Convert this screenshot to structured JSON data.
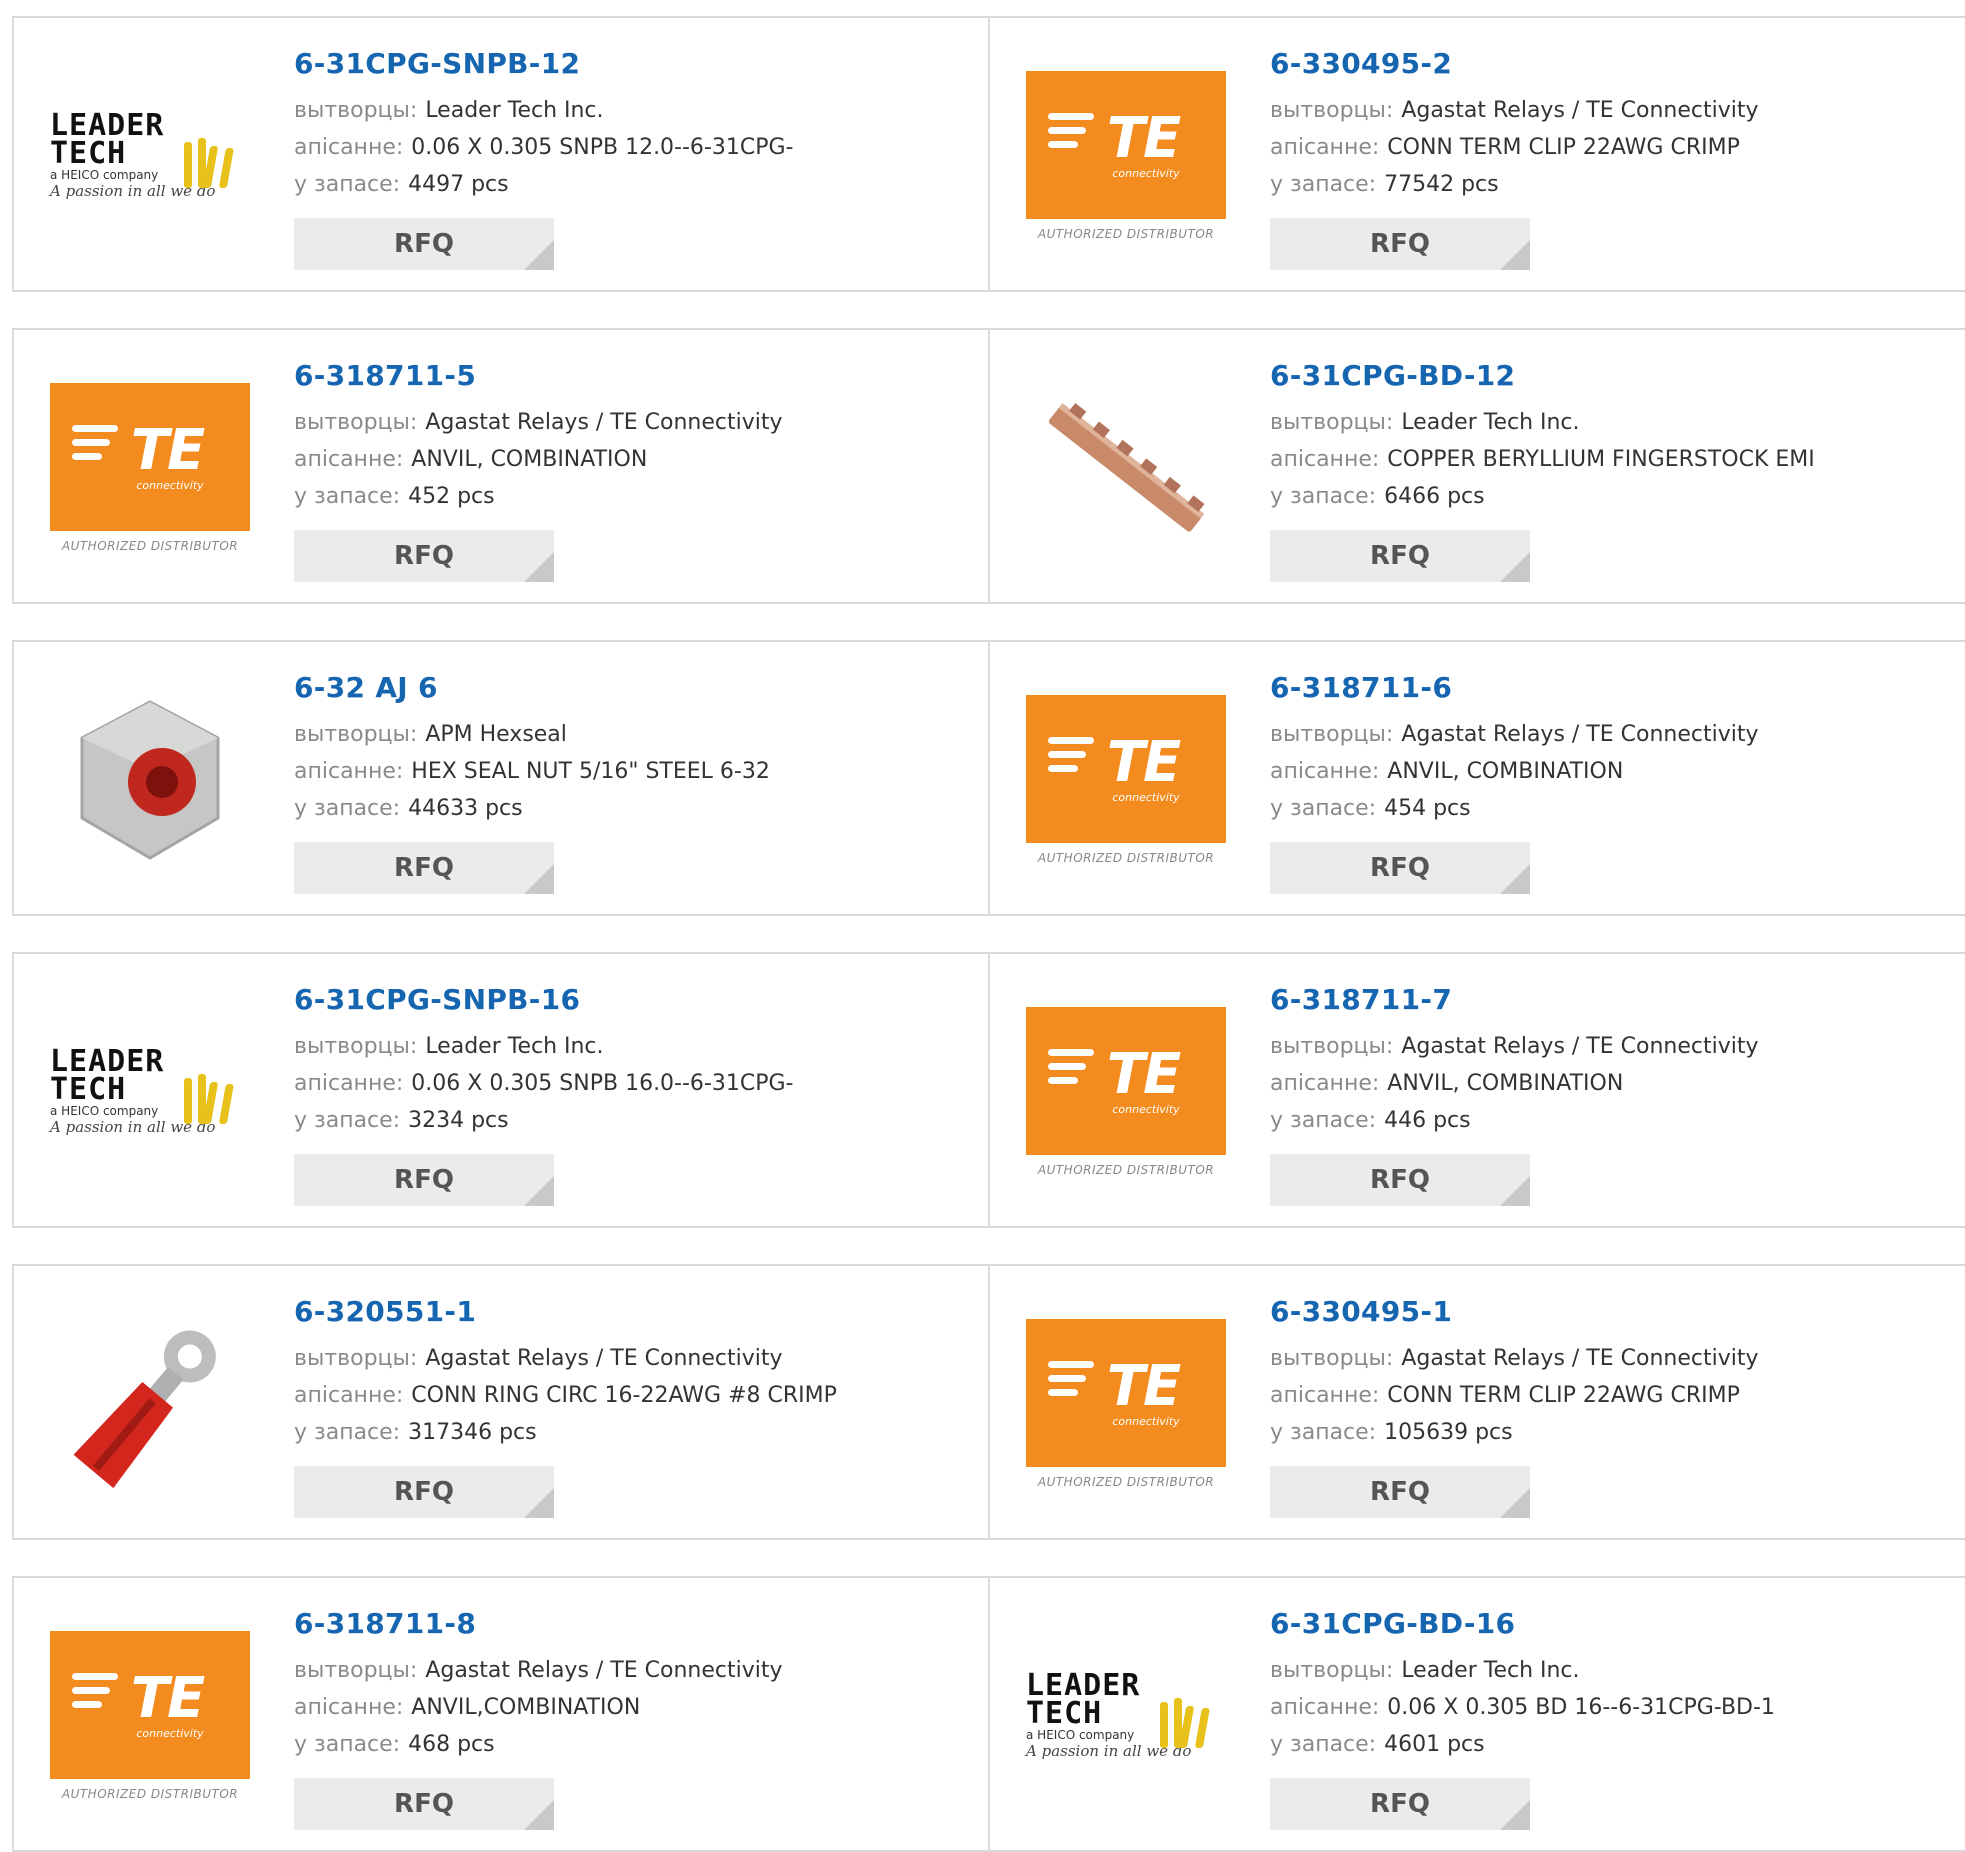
{
  "labels": {
    "manufacturer": "вытворцы:",
    "description": "апісанне:",
    "stock": "у запасе:",
    "rfq": "RFQ"
  },
  "logos": {
    "te_mark": "TE",
    "te_sub": "connectivity",
    "te_auth": "AUTHORIZED DISTRIBUTOR",
    "leader_line1": "LEADER",
    "leader_line2": "TECH",
    "leader_sub": "a HEICO company",
    "leader_script": "A passion in all we do",
    "brand_color": "#f48b1f",
    "link_color": "#1565b0"
  },
  "products": [
    {
      "part": "6-31CPG-SNPB-12",
      "manufacturer": "Leader Tech Inc.",
      "description": "0.06 X 0.305 SNPB 12.0--6-31CPG-",
      "stock": "4497 pcs",
      "image": "leader-tech-logo"
    },
    {
      "part": "6-330495-2",
      "manufacturer": "Agastat Relays / TE Connectivity",
      "description": "CONN TERM CLIP 22AWG CRIMP",
      "stock": "77542 pcs",
      "image": "te-logo"
    },
    {
      "part": "6-318711-5",
      "manufacturer": "Agastat Relays / TE Connectivity",
      "description": "ANVIL, COMBINATION",
      "stock": "452 pcs",
      "image": "te-logo"
    },
    {
      "part": "6-31CPG-BD-12",
      "manufacturer": "Leader Tech Inc.",
      "description": "COPPER BERYLLIUM FINGERSTOCK EMI",
      "stock": "6466 pcs",
      "image": "fingerstock-photo"
    },
    {
      "part": "6-32 AJ 6",
      "manufacturer": "APM Hexseal",
      "description": "HEX SEAL NUT 5/16\" STEEL 6-32",
      "stock": "44633 pcs",
      "image": "hex-nut-photo"
    },
    {
      "part": "6-318711-6",
      "manufacturer": "Agastat Relays / TE Connectivity",
      "description": "ANVIL, COMBINATION",
      "stock": "454 pcs",
      "image": "te-logo"
    },
    {
      "part": "6-31CPG-SNPB-16",
      "manufacturer": "Leader Tech Inc.",
      "description": "0.06 X 0.305 SNPB 16.0--6-31CPG-",
      "stock": "3234 pcs",
      "image": "leader-tech-logo"
    },
    {
      "part": "6-318711-7",
      "manufacturer": "Agastat Relays / TE Connectivity",
      "description": "ANVIL, COMBINATION",
      "stock": "446 pcs",
      "image": "te-logo"
    },
    {
      "part": "6-320551-1",
      "manufacturer": "Agastat Relays / TE Connectivity",
      "description": "CONN RING CIRC 16-22AWG #8 CRIMP",
      "stock": "317346 pcs",
      "image": "ring-terminal-photo"
    },
    {
      "part": "6-330495-1",
      "manufacturer": "Agastat Relays / TE Connectivity",
      "description": "CONN TERM CLIP 22AWG CRIMP",
      "stock": "105639 pcs",
      "image": "te-logo"
    },
    {
      "part": "6-318711-8",
      "manufacturer": "Agastat Relays / TE Connectivity",
      "description": "ANVIL,COMBINATION",
      "stock": "468 pcs",
      "image": "te-logo"
    },
    {
      "part": "6-31CPG-BD-16",
      "manufacturer": "Leader Tech Inc.",
      "description": "0.06 X 0.305 BD 16--6-31CPG-BD-1",
      "stock": "4601 pcs",
      "image": "leader-tech-logo"
    }
  ]
}
